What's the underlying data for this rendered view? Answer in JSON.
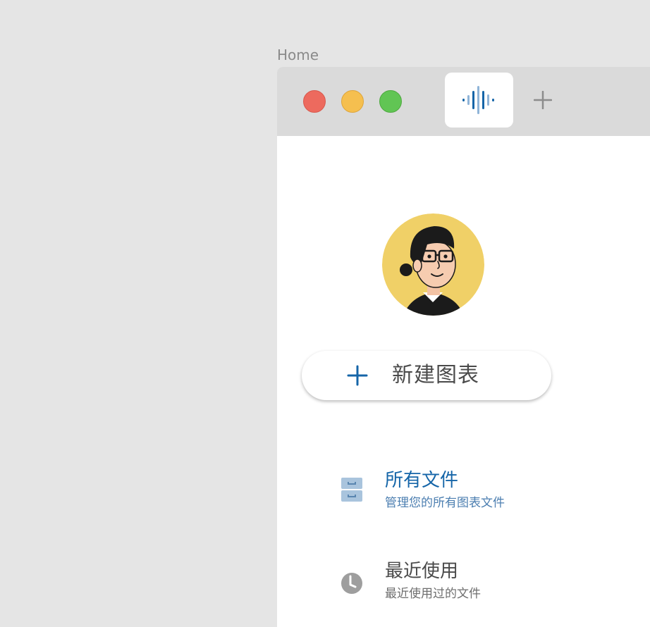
{
  "page": {
    "label": "Home"
  },
  "window": {
    "controls": {
      "close": {
        "icon": "close-dot-icon",
        "color": "#ed6a5e"
      },
      "minimize": {
        "icon": "minimize-dot-icon",
        "color": "#f5bf4f"
      },
      "zoom": {
        "icon": "zoom-dot-icon",
        "color": "#61c554"
      }
    },
    "tab": {
      "icon": "audio-waveform-icon",
      "active": true
    },
    "new_tab": {
      "icon": "plus-icon"
    }
  },
  "profile": {
    "avatar": "user-avatar-illustration",
    "avatar_bg": "#f0d067"
  },
  "new_chart_button": {
    "label": "新建图表",
    "icon": "plus-icon",
    "accent": "#1565a8"
  },
  "nav": {
    "items": [
      {
        "title": "所有文件",
        "subtitle": "管理您的所有图表文件",
        "icon": "file-cabinet-icon",
        "selected": true
      },
      {
        "title": "最近使用",
        "subtitle": "最近使用过的文件",
        "icon": "clock-icon",
        "selected": false
      }
    ]
  }
}
